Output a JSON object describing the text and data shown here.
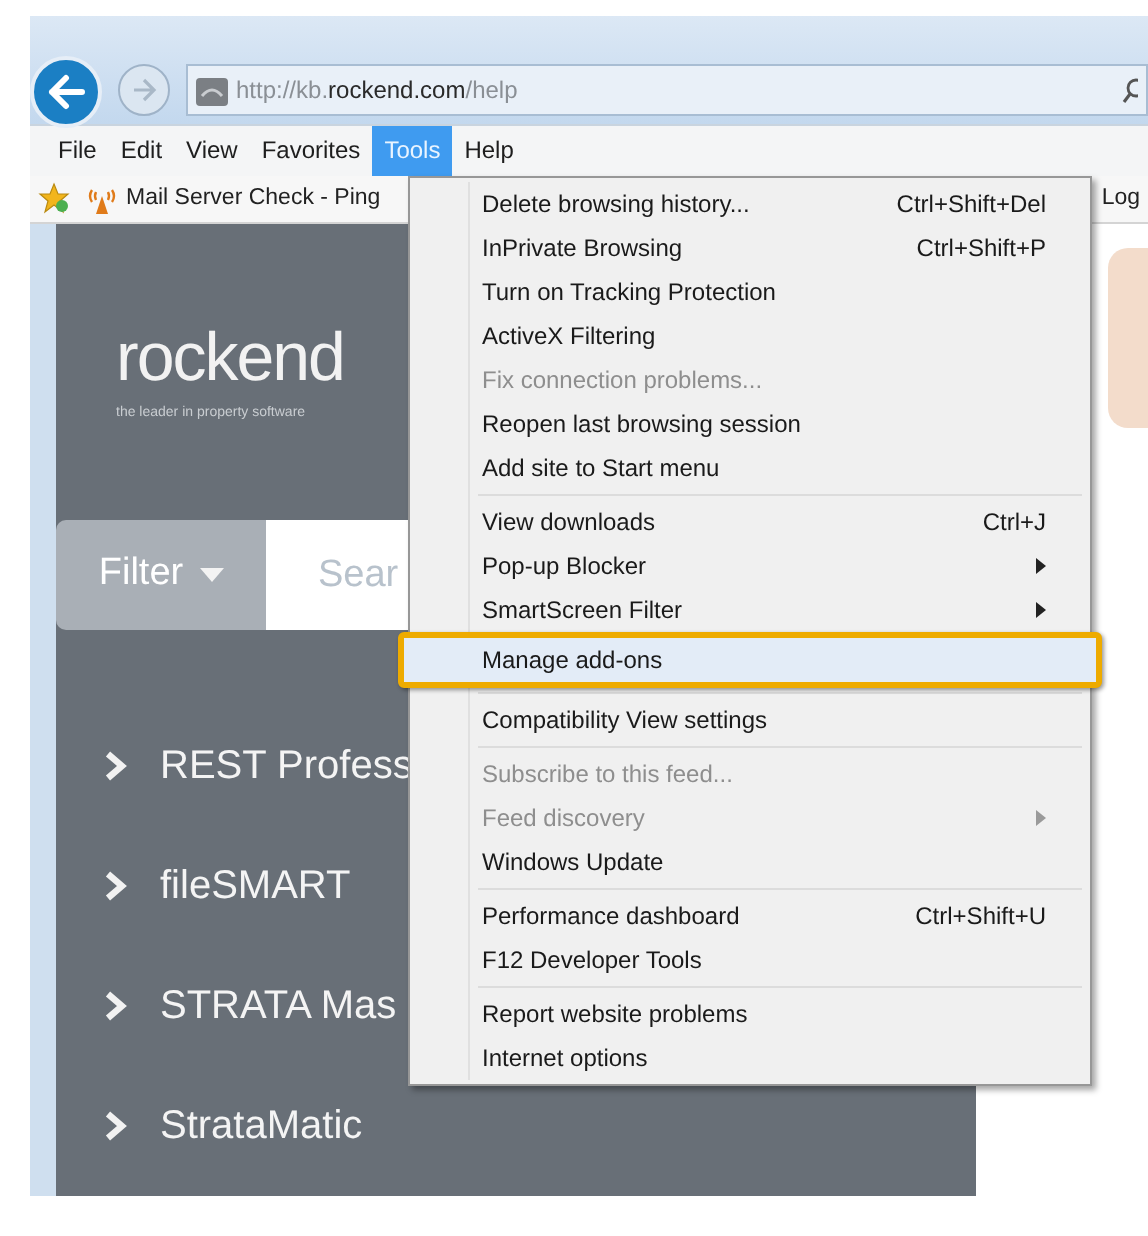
{
  "address_bar": {
    "parts": [
      {
        "text": "http://kb.",
        "emphasis": false
      },
      {
        "text": "rockend.com",
        "emphasis": true
      },
      {
        "text": "/help",
        "emphasis": false
      }
    ]
  },
  "menu_bar": [
    {
      "label": "File",
      "selected": false
    },
    {
      "label": "Edit",
      "selected": false
    },
    {
      "label": "View",
      "selected": false
    },
    {
      "label": "Favorites",
      "selected": false
    },
    {
      "label": "Tools",
      "selected": true
    },
    {
      "label": "Help",
      "selected": false
    }
  ],
  "favorites_bar": {
    "items": [
      "Mail Server Check - Ping"
    ],
    "right_item": "Log"
  },
  "page": {
    "logo": {
      "name": "rockend",
      "tagline": "the leader in property software"
    },
    "filter": {
      "label": "Filter"
    },
    "search": {
      "placeholder": "Sear"
    },
    "nav_items": [
      "REST Profess",
      "fileSMART",
      "STRATA Mas",
      "StrataMatic"
    ]
  },
  "tools_menu": {
    "groups": [
      [
        {
          "label": "Delete browsing history...",
          "shortcut": "Ctrl+Shift+Del",
          "submenu": false,
          "disabled": false,
          "selected": false,
          "callout": false
        },
        {
          "label": "InPrivate Browsing",
          "shortcut": "Ctrl+Shift+P",
          "submenu": false,
          "disabled": false,
          "selected": false,
          "callout": false
        },
        {
          "label": "Turn on Tracking Protection",
          "submenu": false,
          "disabled": false,
          "selected": false,
          "callout": false
        },
        {
          "label": "ActiveX Filtering",
          "submenu": false,
          "disabled": false,
          "selected": false,
          "callout": false
        },
        {
          "label": "Fix connection problems...",
          "submenu": false,
          "disabled": true,
          "selected": false,
          "callout": false
        },
        {
          "label": "Reopen last browsing session",
          "submenu": false,
          "disabled": false,
          "selected": false,
          "callout": false
        },
        {
          "label": "Add site to Start menu",
          "submenu": false,
          "disabled": false,
          "selected": false,
          "callout": false
        }
      ],
      [
        {
          "label": "View downloads",
          "shortcut": "Ctrl+J",
          "submenu": false,
          "disabled": false,
          "selected": false,
          "callout": false
        },
        {
          "label": "Pop-up Blocker",
          "submenu": true,
          "disabled": false,
          "selected": false,
          "callout": false
        },
        {
          "label": "SmartScreen Filter",
          "submenu": true,
          "disabled": false,
          "selected": false,
          "callout": false
        },
        {
          "label": "Manage add-ons",
          "submenu": false,
          "disabled": false,
          "selected": true,
          "callout": true
        }
      ],
      [
        {
          "label": "Compatibility View settings",
          "submenu": false,
          "disabled": false,
          "selected": false,
          "callout": false
        }
      ],
      [
        {
          "label": "Subscribe to this feed...",
          "submenu": false,
          "disabled": true,
          "selected": false,
          "callout": false
        },
        {
          "label": "Feed discovery",
          "submenu": true,
          "disabled": true,
          "selected": false,
          "callout": false
        },
        {
          "label": "Windows Update",
          "submenu": false,
          "disabled": false,
          "selected": false,
          "callout": false
        }
      ],
      [
        {
          "label": "Performance dashboard",
          "shortcut": "Ctrl+Shift+U",
          "submenu": false,
          "disabled": false,
          "selected": false,
          "callout": false
        },
        {
          "label": "F12 Developer Tools",
          "submenu": false,
          "disabled": false,
          "selected": false,
          "callout": false
        }
      ],
      [
        {
          "label": "Report website problems",
          "submenu": false,
          "disabled": false,
          "selected": false,
          "callout": false
        },
        {
          "label": "Internet options",
          "submenu": false,
          "disabled": false,
          "selected": false,
          "callout": false
        }
      ]
    ]
  }
}
